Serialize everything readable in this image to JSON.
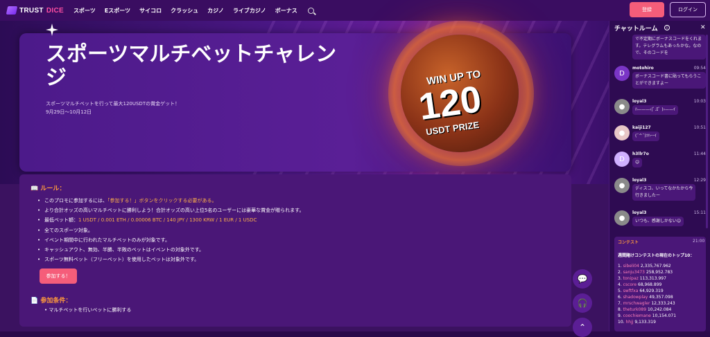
{
  "nav": {
    "logo_main": "TRUST",
    "logo_accent": "DICE",
    "links": [
      "スポーツ",
      "Eスポーツ",
      "サイコロ",
      "クラッシュ",
      "カジノ",
      "ライブカジノ",
      "ボーナス"
    ],
    "register": "登録",
    "login": "ログイン"
  },
  "hero": {
    "title": "スポーツマルチベットチャレンジ",
    "subtitle": "スポーツマルチベットを行って最大120USDTの賞金ゲット！",
    "date": "9月29日〜10月12日",
    "prize_up": "WIN UP TO",
    "prize_num": "120",
    "prize_usdt": "USDT PRIZE"
  },
  "rules": {
    "title": "ルール：",
    "items": [
      {
        "text": "このプロモに参加するには、",
        "hl": "「参加する！」ボタンをクリックする必要がある。"
      },
      {
        "text": "より合計オッズの高いマルチベットに勝利しよう！合計オッズの高い上位5名のユーザーには豪華な賞金が贈られます。",
        "hl": ""
      },
      {
        "text": "最低ベット額：",
        "hl": "1 USDT / 0.001 ETH / 0.00006 BTC / 140 JPY / 1300 KRW / 1 EUR / 1 USDC"
      },
      {
        "text": "全てのスポーツ対象。",
        "hl": ""
      },
      {
        "text": "イベント期間中に行われたマルチベットのみが対象です。",
        "hl": ""
      },
      {
        "text": "キャッシュアウト、無効、半勝、半敗のベットはイベントの対象外です。",
        "hl": ""
      },
      {
        "text": "スポーツ無料ベット（フリーベット）を使用したベットは対象外です。",
        "hl": ""
      }
    ],
    "join": "参加する！",
    "cond_title": "参加条件：",
    "cond_first": "マルチベットを行いベットに勝利する"
  },
  "chat": {
    "title": "チャットルーム",
    "top_bubble": "で不定期にボーナスコードをくれます。テレグラムもあったかな。なので、そのコードを",
    "messages": [
      {
        "name": "motohiro",
        "time": "09:54",
        "text1": "ボーナスコード書に貼ってもらうことができますよー",
        "text2": "",
        "avatar": "D"
      },
      {
        "name": "loyal3",
        "time": "10:03",
        "text1": "ﾊ———‹(ﾟ.ﾛﾟ )›——ｲ",
        "text2": "",
        "avatar": "●"
      },
      {
        "name": "kaiji127",
        "time": "10:51",
        "text1": "(¯^¯)ﾂﾊｰｰｲ",
        "text2": "",
        "avatar": "●"
      },
      {
        "name": "h3llr7o",
        "time": "11:44",
        "text1": "☺",
        "text2": "",
        "avatar": "D"
      },
      {
        "name": "loyal3",
        "time": "12:29",
        "text1": "ディスコ、いってなかたから今",
        "text2": "行きましたー",
        "avatar": "●"
      },
      {
        "name": "loyal3",
        "time": "15:11",
        "text1": "いつも、感謝しかない☺",
        "text2": "",
        "avatar": "●"
      }
    ],
    "contest": {
      "head": "コンテスト",
      "time": "21:00",
      "sub": "週間賭けコンテストの現在のトップ10：",
      "rows": [
        {
          "rank": "1.",
          "user": "sibeli04",
          "amount": "2,335,767.962"
        },
        {
          "rank": "2.",
          "user": "sanju3473",
          "amount": "258,952.783"
        },
        {
          "rank": "3.",
          "user": "tonipaz",
          "amount": "113,313.997"
        },
        {
          "rank": "4.",
          "user": "cscore",
          "amount": "68,968.899"
        },
        {
          "rank": "5.",
          "user": "swftfxa",
          "amount": "64,929.319"
        },
        {
          "rank": "6.",
          "user": "shadowplay",
          "amount": "49,357.098"
        },
        {
          "rank": "7.",
          "user": "mrschwagler",
          "amount": "12,333.243"
        },
        {
          "rank": "8.",
          "user": "theturk089",
          "amount": "10,242.084"
        },
        {
          "rank": "9.",
          "user": "coochiemane",
          "amount": "10,154.071"
        },
        {
          "rank": "10.",
          "user": "hhjj",
          "amount": "9,133.319"
        }
      ]
    }
  }
}
